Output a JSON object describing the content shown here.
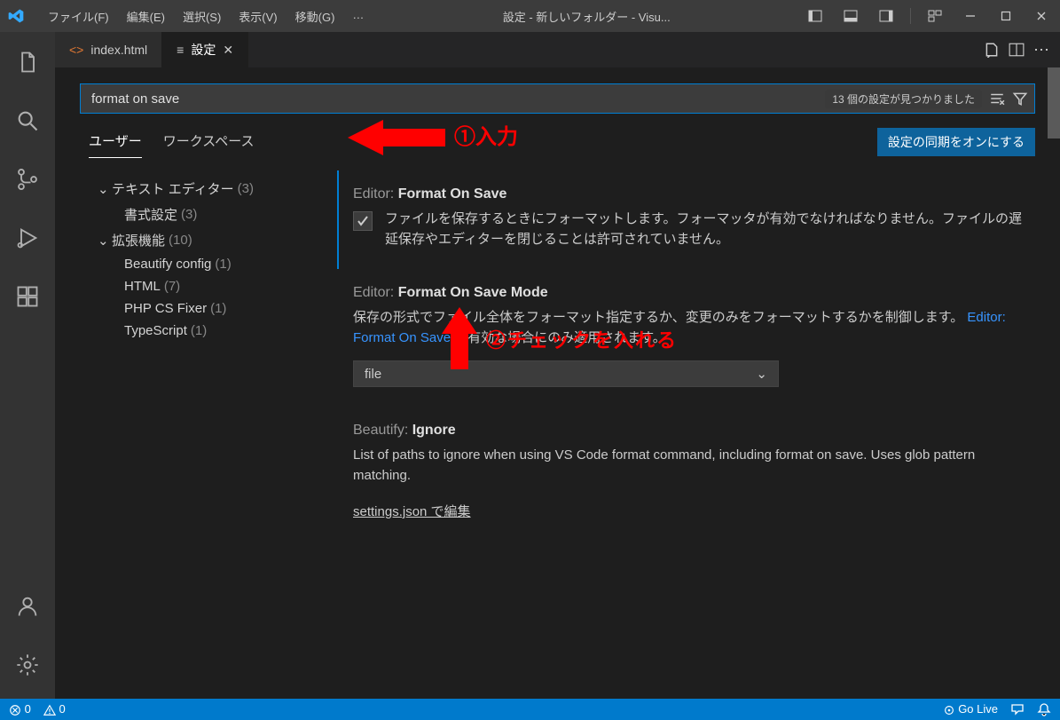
{
  "titlebar": {
    "menus": [
      "ファイル(F)",
      "編集(E)",
      "選択(S)",
      "表示(V)",
      "移動(G)",
      "…"
    ],
    "title": "設定 - 新しいフォルダー - Visu..."
  },
  "tabs": {
    "items": [
      {
        "label": "index.html",
        "icon": "html-file-icon"
      },
      {
        "label": "設定",
        "icon": "settings-tab-icon"
      }
    ]
  },
  "search": {
    "value": "format on save",
    "result_count": "13 個の設定が見つかりました"
  },
  "scope": {
    "user": "ユーザー",
    "workspace": "ワークスペース",
    "sync_button": "設定の同期をオンにする"
  },
  "toc": [
    {
      "label": "テキスト エディター",
      "count": "(3)",
      "level": 1,
      "expanded": true
    },
    {
      "label": "書式設定",
      "count": "(3)",
      "level": 2,
      "expanded": false
    },
    {
      "label": "拡張機能",
      "count": "(10)",
      "level": 1,
      "expanded": true
    },
    {
      "label": "Beautify config",
      "count": "(1)",
      "level": 2,
      "expanded": false
    },
    {
      "label": "HTML",
      "count": "(7)",
      "level": 2,
      "expanded": false
    },
    {
      "label": "PHP CS Fixer",
      "count": "(1)",
      "level": 2,
      "expanded": false
    },
    {
      "label": "TypeScript",
      "count": "(1)",
      "level": 2,
      "expanded": false
    }
  ],
  "settings": {
    "item1": {
      "scope": "Editor: ",
      "name": "Format On Save",
      "desc": "ファイルを保存するときにフォーマットします。フォーマッタが有効でなければなりません。ファイルの遅延保存やエディターを閉じることは許可されていません。",
      "checked": true
    },
    "item2": {
      "scope": "Editor: ",
      "name": "Format On Save Mode",
      "desc_pre": "保存の形式でファイル全体をフォーマット指定するか、変更のみをフォーマットするかを制御します。",
      "link": "Editor: Format On Save",
      "desc_post": " が有効な場合にのみ適用されます。",
      "value": "file"
    },
    "item3": {
      "scope": "Beautify: ",
      "name": "Ignore",
      "desc": "List of paths to ignore when using VS Code format command, including format on save. Uses glob pattern matching.",
      "edit_link": "settings.json で編集"
    }
  },
  "statusbar": {
    "errors": "0",
    "warnings": "0",
    "golive": "Go Live"
  },
  "annotations": {
    "a1": "①入力",
    "a2": "②チェックを入れる"
  }
}
